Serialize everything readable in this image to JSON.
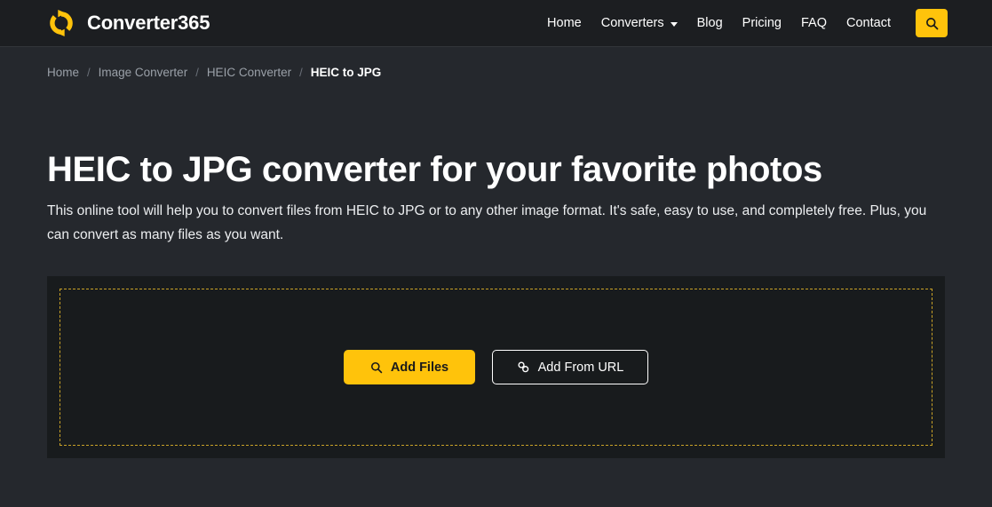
{
  "colors": {
    "accent": "#ffc30b",
    "page_bg": "#25282d",
    "header_bg": "#1c1e21",
    "card_bg": "#181b1d",
    "dashed_border": "#c9a227",
    "muted_text": "#9aa0a8"
  },
  "header": {
    "brand_name": "Converter365",
    "brand_icon": "refresh-convert-icon",
    "nav": [
      {
        "label": "Home",
        "has_dropdown": false
      },
      {
        "label": "Converters",
        "has_dropdown": true
      },
      {
        "label": "Blog",
        "has_dropdown": false
      },
      {
        "label": "Pricing",
        "has_dropdown": false
      },
      {
        "label": "FAQ",
        "has_dropdown": false
      },
      {
        "label": "Contact",
        "has_dropdown": false
      }
    ],
    "search_icon": "search-icon"
  },
  "breadcrumb": {
    "separator": "/",
    "items": [
      {
        "label": "Home",
        "current": false
      },
      {
        "label": "Image Converter",
        "current": false
      },
      {
        "label": "HEIC Converter",
        "current": false
      },
      {
        "label": "HEIC to JPG",
        "current": true
      }
    ]
  },
  "main": {
    "title": "HEIC to JPG converter for your favorite photos",
    "description": "This online tool will help you to convert files from HEIC to JPG or to any other image format. It's safe, easy to use, and completely free. Plus, you can convert as many files as you want."
  },
  "uploader": {
    "add_files_label": "Add Files",
    "add_files_icon": "search-icon",
    "add_from_url_label": "Add From URL",
    "add_from_url_icon": "link-icon"
  }
}
